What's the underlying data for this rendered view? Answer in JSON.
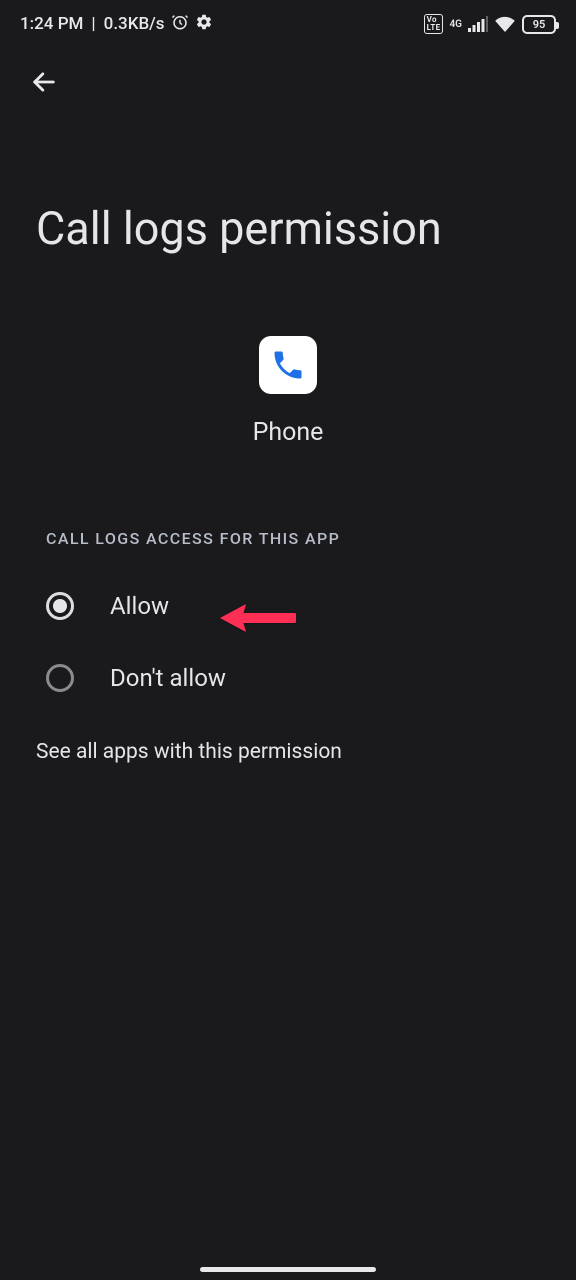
{
  "status": {
    "time": "1:24 PM",
    "net_speed": "0.3KB/s",
    "battery_pct": "95",
    "net_type_top": "4G",
    "volte": "Vo\nLTE"
  },
  "header": {
    "title": "Call logs permission"
  },
  "app": {
    "name": "Phone"
  },
  "section_label": "CALL LOGS ACCESS FOR THIS APP",
  "options": {
    "allow": {
      "label": "Allow",
      "selected": true
    },
    "deny": {
      "label": "Don't allow",
      "selected": false
    }
  },
  "footer_link": "See all apps with this permission",
  "colors": {
    "bg": "#1a1a1c",
    "text": "#e6e6e8",
    "muted": "#b7bdc9",
    "accent_arrow": "#ff2d55"
  }
}
